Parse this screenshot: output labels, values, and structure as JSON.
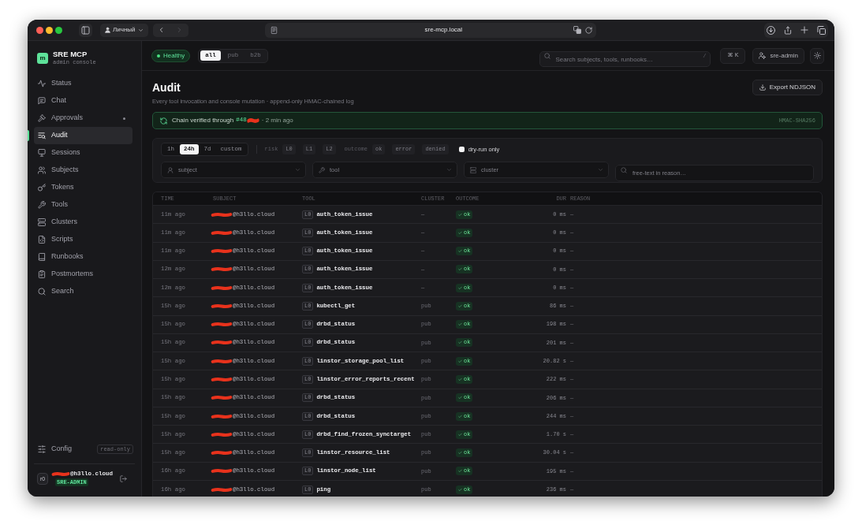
{
  "browser": {
    "profile": "Личный",
    "forward_disabled": true,
    "address": "sre-mcp.local"
  },
  "app": {
    "logo": "m",
    "name": "SRE MCP",
    "tagline": "admin console"
  },
  "header": {
    "health": {
      "label": "Healthy",
      "kind": "ok"
    },
    "scopes": [
      {
        "label": "all",
        "selected": true
      },
      {
        "label": "pub",
        "selected": false
      },
      {
        "label": "b2b",
        "selected": false
      }
    ],
    "search": {
      "placeholder": "Search subjects, tools, runbooks…",
      "shortcut": "/"
    },
    "command_button": "⌘ K",
    "user_button": "sre-admin"
  },
  "sidebar": {
    "items": [
      {
        "label": "Status",
        "selected": false,
        "indicator": false
      },
      {
        "label": "Chat",
        "selected": false,
        "indicator": false
      },
      {
        "label": "Approvals",
        "selected": false,
        "indicator": true
      },
      {
        "label": "Audit",
        "selected": true,
        "indicator": false
      },
      {
        "label": "Sessions",
        "selected": false,
        "indicator": false
      },
      {
        "label": "Subjects",
        "selected": false,
        "indicator": false
      },
      {
        "label": "Tokens",
        "selected": false,
        "indicator": false
      },
      {
        "label": "Tools",
        "selected": false,
        "indicator": false
      },
      {
        "label": "Clusters",
        "selected": false,
        "indicator": false
      },
      {
        "label": "Scripts",
        "selected": false,
        "indicator": false
      },
      {
        "label": "Runbooks",
        "selected": false,
        "indicator": false
      },
      {
        "label": "Postmortems",
        "selected": false,
        "indicator": false
      },
      {
        "label": "Search",
        "selected": false,
        "indicator": false
      }
    ],
    "config": {
      "label": "Config",
      "badge": "read-only"
    },
    "user": {
      "avatar": "r0",
      "email": "@h3llo.cloud",
      "redacted": true,
      "role": "SRE-ADMIN"
    }
  },
  "page": {
    "title": "Audit",
    "description": "Every tool invocation and console mutation · append-only HMAC-chained log",
    "export_button": "Export NDJSON"
  },
  "chain": {
    "text": "Chain verified through",
    "block": "#48",
    "redacted": true,
    "age": "· 2 min ago",
    "algorithm": "HMAC-SHA256"
  },
  "filters": {
    "ranges": [
      {
        "label": "1h",
        "selected": false
      },
      {
        "label": "24h",
        "selected": true
      },
      {
        "label": "7d",
        "selected": false
      },
      {
        "label": "custom",
        "selected": false
      }
    ],
    "risk": {
      "label": "risk",
      "options": [
        {
          "label": "L0",
          "selected": false
        },
        {
          "label": "L1",
          "selected": false
        },
        {
          "label": "L2",
          "selected": false
        }
      ]
    },
    "outcome": {
      "label": "outcome",
      "options": [
        {
          "label": "ok",
          "selected": false
        },
        {
          "label": "error",
          "selected": false
        },
        {
          "label": "denied",
          "selected": false
        }
      ]
    },
    "dry_run": {
      "label": "dry-run only",
      "checked": false
    },
    "fields": [
      {
        "placeholder": "subject",
        "kind": "select"
      },
      {
        "placeholder": "tool",
        "kind": "select"
      },
      {
        "placeholder": "cluster",
        "kind": "select"
      },
      {
        "placeholder": "free-text in reason…",
        "kind": "text"
      }
    ]
  },
  "table": {
    "columns": [
      "TIME",
      "SUBJECT",
      "TOOL",
      "CLUSTER",
      "OUTCOME",
      "DUR",
      "REASON"
    ],
    "rows": [
      {
        "time": "11m ago",
        "subject": "@h3llo.cloud",
        "redacted": true,
        "risk": "L0",
        "tool": "auth_token_issue",
        "cluster": "—",
        "outcome": {
          "label": "ok",
          "kind": "ok"
        },
        "duration": "0 ms",
        "reason": "—"
      },
      {
        "time": "11m ago",
        "subject": "@h3llo.cloud",
        "redacted": true,
        "risk": "L0",
        "tool": "auth_token_issue",
        "cluster": "—",
        "outcome": {
          "label": "ok",
          "kind": "ok"
        },
        "duration": "0 ms",
        "reason": "—"
      },
      {
        "time": "11m ago",
        "subject": "@h3llo.cloud",
        "redacted": true,
        "risk": "L0",
        "tool": "auth_token_issue",
        "cluster": "—",
        "outcome": {
          "label": "ok",
          "kind": "ok"
        },
        "duration": "0 ms",
        "reason": "—"
      },
      {
        "time": "12m ago",
        "subject": "@h3llo.cloud",
        "redacted": true,
        "risk": "L0",
        "tool": "auth_token_issue",
        "cluster": "—",
        "outcome": {
          "label": "ok",
          "kind": "ok"
        },
        "duration": "0 ms",
        "reason": "—"
      },
      {
        "time": "12m ago",
        "subject": "@h3llo.cloud",
        "redacted": true,
        "risk": "L0",
        "tool": "auth_token_issue",
        "cluster": "—",
        "outcome": {
          "label": "ok",
          "kind": "ok"
        },
        "duration": "0 ms",
        "reason": "—"
      },
      {
        "time": "15h ago",
        "subject": "@h3llo.cloud",
        "redacted": true,
        "risk": "L0",
        "tool": "kubectl_get",
        "cluster": "pub",
        "outcome": {
          "label": "ok",
          "kind": "ok"
        },
        "duration": "86 ms",
        "reason": "—"
      },
      {
        "time": "15h ago",
        "subject": "@h3llo.cloud",
        "redacted": true,
        "risk": "L0",
        "tool": "drbd_status",
        "cluster": "pub",
        "outcome": {
          "label": "ok",
          "kind": "ok"
        },
        "duration": "198 ms",
        "reason": "—"
      },
      {
        "time": "15h ago",
        "subject": "@h3llo.cloud",
        "redacted": true,
        "risk": "L0",
        "tool": "drbd_status",
        "cluster": "pub",
        "outcome": {
          "label": "ok",
          "kind": "ok"
        },
        "duration": "201 ms",
        "reason": "—"
      },
      {
        "time": "15h ago",
        "subject": "@h3llo.cloud",
        "redacted": true,
        "risk": "L0",
        "tool": "linstor_storage_pool_list",
        "cluster": "pub",
        "outcome": {
          "label": "ok",
          "kind": "ok"
        },
        "duration": "20.82 s",
        "reason": "—"
      },
      {
        "time": "15h ago",
        "subject": "@h3llo.cloud",
        "redacted": true,
        "risk": "L0",
        "tool": "linstor_error_reports_recent",
        "cluster": "pub",
        "outcome": {
          "label": "ok",
          "kind": "ok"
        },
        "duration": "222 ms",
        "reason": "—"
      },
      {
        "time": "15h ago",
        "subject": "@h3llo.cloud",
        "redacted": true,
        "risk": "L0",
        "tool": "drbd_status",
        "cluster": "pub",
        "outcome": {
          "label": "ok",
          "kind": "ok"
        },
        "duration": "206 ms",
        "reason": "—"
      },
      {
        "time": "15h ago",
        "subject": "@h3llo.cloud",
        "redacted": true,
        "risk": "L0",
        "tool": "drbd_status",
        "cluster": "pub",
        "outcome": {
          "label": "ok",
          "kind": "ok"
        },
        "duration": "244 ms",
        "reason": "—"
      },
      {
        "time": "15h ago",
        "subject": "@h3llo.cloud",
        "redacted": true,
        "risk": "L0",
        "tool": "drbd_find_frozen_synctarget",
        "cluster": "pub",
        "outcome": {
          "label": "ok",
          "kind": "ok"
        },
        "duration": "1.70 s",
        "reason": "—"
      },
      {
        "time": "15h ago",
        "subject": "@h3llo.cloud",
        "redacted": true,
        "risk": "L0",
        "tool": "linstor_resource_list",
        "cluster": "pub",
        "outcome": {
          "label": "ok",
          "kind": "ok"
        },
        "duration": "30.04 s",
        "reason": "—"
      },
      {
        "time": "16h ago",
        "subject": "@h3llo.cloud",
        "redacted": true,
        "risk": "L0",
        "tool": "linstor_node_list",
        "cluster": "pub",
        "outcome": {
          "label": "ok",
          "kind": "ok"
        },
        "duration": "195 ms",
        "reason": "—"
      },
      {
        "time": "16h ago",
        "subject": "@h3llo.cloud",
        "redacted": true,
        "risk": "L0",
        "tool": "ping",
        "cluster": "pub",
        "outcome": {
          "label": "ok",
          "kind": "ok"
        },
        "duration": "236 ms",
        "reason": "—"
      }
    ]
  }
}
